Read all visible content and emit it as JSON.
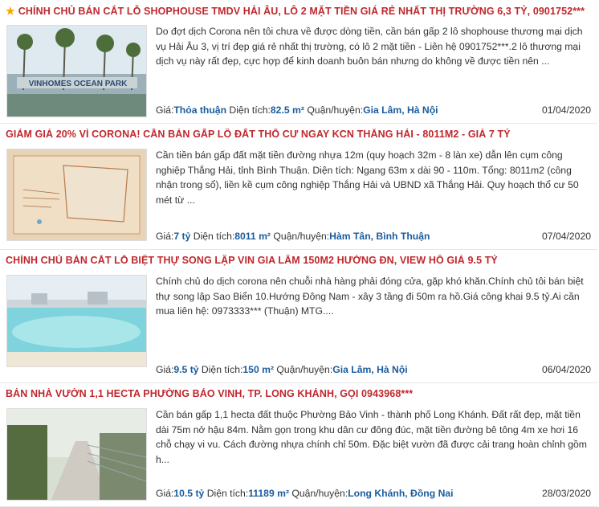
{
  "listings": [
    {
      "title": "CHÍNH CHỦ BÁN CẮT LỖ SHOPHOUSE TMDV HẢI ÂU, LÔ 2 MẶT TIỀN GIÁ RẺ NHẤT THỊ TRƯỜNG 6,3 TỶ, 0901752***",
      "featured": true,
      "description": "Do đợt dịch Corona nên tôi chưa về được dòng tiền, cần bán gấp 2 lô shophouse thương mại dịch vụ Hải Âu 3, vị trí đẹp giá rẻ nhất thị trường, có lô 2 mặt tiền - Liên hệ 0901752***.2 lô thương mại dịch vụ này rất đẹp, cực hợp để kinh doanh buôn bán nhưng do không về được tiền nên ...",
      "price_label": "Giá:",
      "price": "Thỏa thuận",
      "area_label": "Diện tích:",
      "area": "82.5 m²",
      "district_label": "Quận/huyện:",
      "district": "Gia Lâm, Hà Nội",
      "date": "01/04/2020",
      "thumb_text": "VINHOMES OCEAN PARK"
    },
    {
      "title": "GIẢM GIÁ 20% VÌ CORONA! CẦN BÁN GẤP LÔ ĐẤT THỔ CƯ NGAY KCN THẮNG HẢI - 8011M2 - GIÁ 7 TỶ",
      "featured": false,
      "description": "Cần tiền bán gấp đất mặt tiền đường nhựa 12m (quy hoạch 32m - 8 làn xe) dẫn lên cụm công nghiệp Thắng Hải, tỉnh Bình Thuận. Diện tích: Ngang 63m x dài 90 - 110m. Tổng: 8011m2 (công nhận trong sổ), liền kề cụm công nghiệp Thắng Hải và UBND xã Thắng Hải. Quy hoạch thổ cư 50 mét từ ...",
      "price_label": "Giá:",
      "price": "7 tỷ",
      "area_label": "Diện tích:",
      "area": "8011 m²",
      "district_label": "Quận/huyện:",
      "district": "Hàm Tân, Bình Thuận",
      "date": "07/04/2020"
    },
    {
      "title": "CHÍNH CHỦ BÁN CẮT LỖ BIỆT THỰ SONG LẬP VIN GIA LÂM 150M2 HƯỚNG ĐN, VIEW HỒ GIÁ 9.5 TỶ",
      "featured": false,
      "description": "Chính chủ do dịch corona nên chuỗi nhà hàng phải đóng cửa, gặp khó khăn.Chính chủ tôi bán biệt thự song lập Sao Biển 10.Hướng Đông Nam - xây 3 tầng đi 50m ra hồ.Giá công khai 9.5 tỷ.Ai cần mua liên hệ: 0973333*** (Thuận) MTG....",
      "price_label": "Giá:",
      "price": "9.5 tỷ",
      "area_label": "Diện tích:",
      "area": "150 m²",
      "district_label": "Quận/huyện:",
      "district": "Gia Lâm, Hà Nội",
      "date": "06/04/2020"
    },
    {
      "title": "BÁN NHÀ VƯỜN 1,1 HECTA PHƯỜNG BẢO VINH, TP. LONG KHÁNH, GỌI 0943968***",
      "featured": false,
      "description": "Cần bán gấp 1,1 hecta đất thuộc Phường Bảo Vinh - thành phố Long Khánh. Đất rất đẹp, mặt tiền dài 75m nở hậu 84m. Nằm gọn trong khu dân cư đông đúc, mặt tiền đường bê tông 4m xe hơi 16 chỗ chạy vi vu. Cách đường nhựa chính chỉ 50m. Đặc biệt vườn đã được cải trang hoàn chỉnh gồm h...",
      "price_label": "Giá:",
      "price": "10.5 tỷ",
      "area_label": "Diện tích:",
      "area": "11189 m²",
      "district_label": "Quận/huyện:",
      "district": "Long Khánh, Đồng Nai",
      "date": "28/03/2020"
    }
  ],
  "colors": {
    "title": "#c0272d",
    "value": "#1a5c9e",
    "star": "#f2a900"
  }
}
